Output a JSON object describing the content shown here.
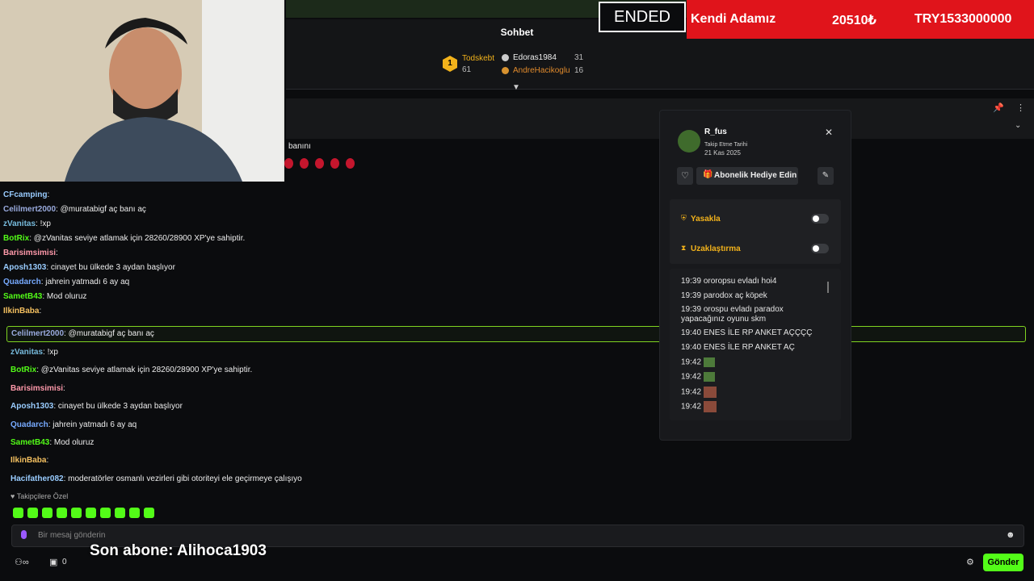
{
  "banner": {
    "ended": "ENDED",
    "name": "Kendi Adamız",
    "amount": "20510₺",
    "total": "TRY1533000000"
  },
  "chat": {
    "title": "Sohbet",
    "leaderboard": [
      {
        "rank": "1",
        "name": "Todskebt",
        "value": "61"
      },
      {
        "name": "Edoras1984",
        "value": "31"
      },
      {
        "name": "AndreHacikoglu",
        "value": "16"
      }
    ],
    "pinned_fragment": "banını",
    "overlay_messages": [
      {
        "user": "CFcamping",
        "text": ":"
      },
      {
        "user": "Celilmert2000",
        "text": ": @muratabigf aç banı aç"
      },
      {
        "user": "zVanitas",
        "text": ": !xp"
      },
      {
        "user": "BotRix",
        "text": ": @zVanitas seviye atlamak için 28260/28900 XP'ye sahiptir."
      },
      {
        "user": "Barisimsimisi",
        "text": ":"
      },
      {
        "user": "Aposh1303",
        "text": ": cinayet bu ülkede 3 aydan başlıyor"
      },
      {
        "user": "Quadarch",
        "text": ": jahrein yatmadı 6 ay aq"
      },
      {
        "user": "SametB43",
        "text": ": Mod oluruz"
      },
      {
        "user": "IlkinBaba",
        "text": ":"
      }
    ],
    "highlight": {
      "user": "Celilmert2000",
      "text": ": @muratabigf aç banı aç"
    },
    "messages": [
      {
        "user": "zVanitas",
        "text": ": !xp"
      },
      {
        "user": "BotRix",
        "text": ": @zVanitas seviye atlamak için 28260/28900 XP'ye sahiptir."
      },
      {
        "user": "Barisimsimisi",
        "text": ":"
      },
      {
        "user": "Aposh1303",
        "text": ": cinayet bu ülkede 3 aydan başlıyor"
      },
      {
        "user": "Quadarch",
        "text": ": jahrein yatmadı 6 ay aq"
      },
      {
        "user": "SametB43",
        "text": ": Mod oluruz"
      },
      {
        "user": "IlkinBaba",
        "text": ":"
      },
      {
        "user": "Hacifather082",
        "text": ": moderatörler osmanlı vezirleri gibi otoriteyi ele geçirmeye çalışıyo"
      }
    ],
    "followers_only": "Takipçilere Özel",
    "input_placeholder": "Bir mesaj gönderin",
    "subscriber_overlay": "Son abone: Alihoca1903",
    "viewer_count": "0",
    "send_label": "Gönder"
  },
  "panel": {
    "username": "R_fus",
    "follow_label": "Takip Etme Tarihi",
    "follow_date": "21 Kas 2025",
    "gift_label": "Abonelik Hediye Edin",
    "ban_label": "Yasakla",
    "timeout_label": "Uzaklaştırma",
    "log": [
      {
        "time": "19:39",
        "text": "ororopsu evladı hoi4"
      },
      {
        "time": "19:39",
        "text": "parodox aç köpek"
      },
      {
        "time": "19:39",
        "text": "orospu evladı paradox yapacağınız oyunu skm"
      },
      {
        "time": "19:40",
        "text": "ENES İLE RP ANKET AÇÇÇÇ"
      },
      {
        "time": "19:40",
        "text": "ENES İLE RP ANKET AÇ"
      },
      {
        "time": "19:42",
        "text": ""
      },
      {
        "time": "19:42",
        "text": ""
      },
      {
        "time": "19:42",
        "text": ""
      },
      {
        "time": "19:42",
        "text": ""
      }
    ]
  },
  "colors": {
    "accent": "#53fc18",
    "banner_red": "#e0141b"
  }
}
